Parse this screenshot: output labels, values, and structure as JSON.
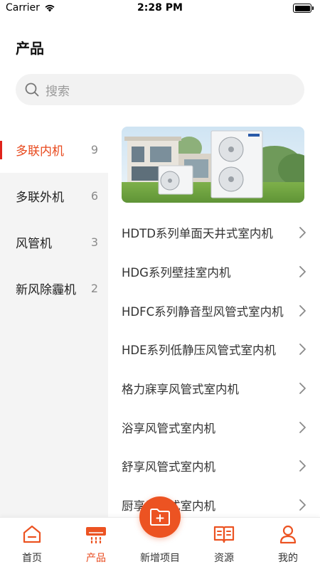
{
  "status_bar": {
    "carrier": "Carrier",
    "time": "2:28 PM"
  },
  "header": {
    "title": "产品"
  },
  "search": {
    "placeholder": "搜索"
  },
  "categories": [
    {
      "label": "多联内机",
      "count": "9",
      "active": true
    },
    {
      "label": "多联外机",
      "count": "6",
      "active": false
    },
    {
      "label": "风管机",
      "count": "3",
      "active": false
    },
    {
      "label": "新风除霾机",
      "count": "2",
      "active": false
    }
  ],
  "products": [
    "HDTD系列单面天井式室内机",
    "HDG系列壁挂室内机",
    "HDFC系列静音型风管式室内机",
    "HDE系列低静压风管式室内机",
    "格力寐享风管式室内机",
    "浴享风管式室内机",
    "舒享风管式室内机",
    "厨享风管式室内机"
  ],
  "tabs": [
    {
      "label": "首页",
      "icon": "home-icon"
    },
    {
      "label": "产品",
      "icon": "air-conditioner-icon"
    },
    {
      "label": "新增项目",
      "icon": "add-folder-icon"
    },
    {
      "label": "资源",
      "icon": "book-icon"
    },
    {
      "label": "我的",
      "icon": "user-icon"
    }
  ],
  "colors": {
    "accent": "#e8491d",
    "active_bar": "#e0231b",
    "fab": "#ec5322"
  }
}
